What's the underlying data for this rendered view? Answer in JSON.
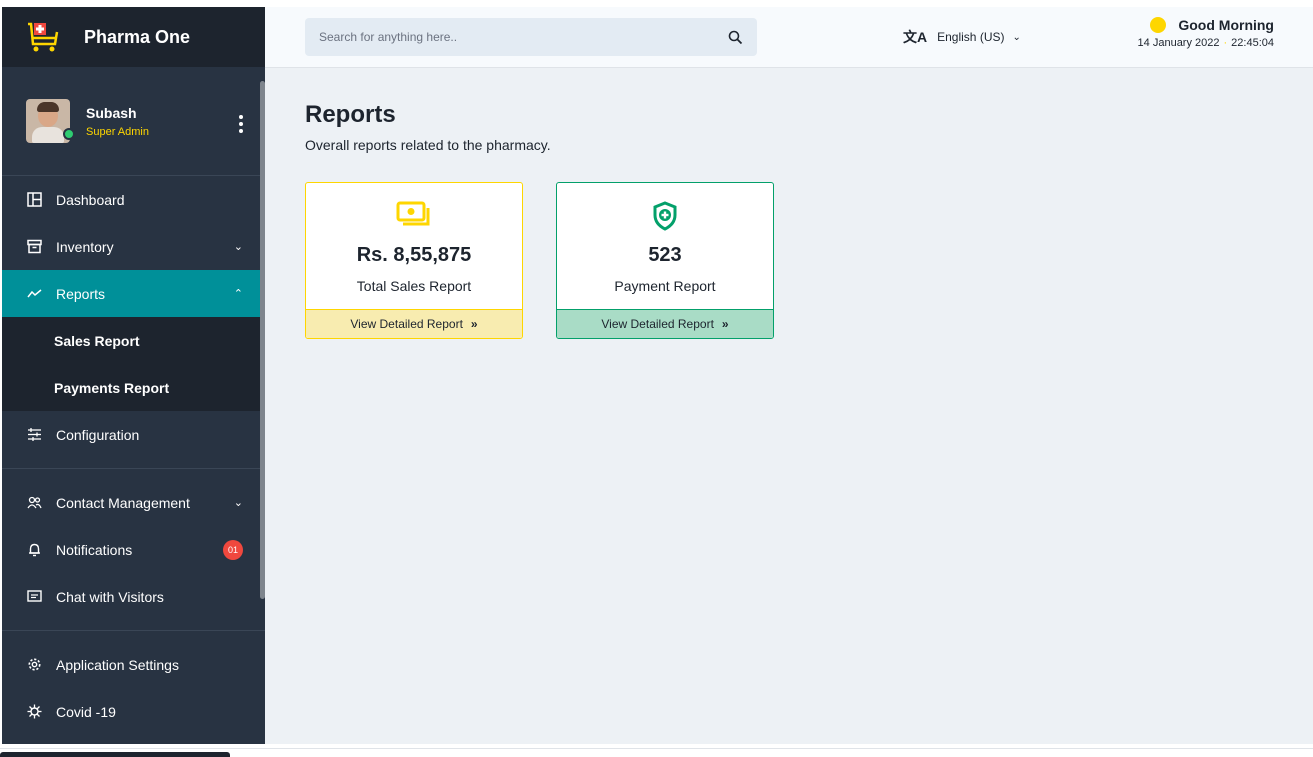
{
  "app": {
    "name": "Pharma One"
  },
  "user": {
    "name": "Subash",
    "role": "Super Admin"
  },
  "sidebar": {
    "items": [
      {
        "label": "Dashboard",
        "icon": "dashboard-icon"
      },
      {
        "label": "Inventory",
        "icon": "inventory-icon"
      },
      {
        "label": "Reports",
        "icon": "reports-icon",
        "active": true
      },
      {
        "label": "Configuration",
        "icon": "configuration-icon"
      },
      {
        "label": "Contact Management",
        "icon": "contacts-icon"
      },
      {
        "label": "Notifications",
        "icon": "bell-icon",
        "badge": "01"
      },
      {
        "label": "Chat with Visitors",
        "icon": "chat-icon"
      },
      {
        "label": "Application Settings",
        "icon": "gear-icon"
      },
      {
        "label": "Covid -19",
        "icon": "virus-icon"
      }
    ],
    "reports_sub": [
      "Sales Report",
      "Payments Report"
    ]
  },
  "header": {
    "search_placeholder": "Search for anything here..",
    "language": "English (US)",
    "greeting": "Good Morning",
    "date": "14 January 2022",
    "time": "22:45:04"
  },
  "page": {
    "title": "Reports",
    "subtitle": "Overall reports related to the pharmacy."
  },
  "cards": [
    {
      "value": "Rs. 8,55,875",
      "label": "Total Sales Report",
      "link": "View Detailed Report",
      "accent": "#FED600"
    },
    {
      "value": "523",
      "label": "Payment Report",
      "link": "View Detailed Report",
      "accent": "#03A06A"
    }
  ],
  "colors": {
    "sidebar": "#283342",
    "brand_bar": "#1D242E",
    "active": "#009099",
    "badge": "#F0483E"
  }
}
